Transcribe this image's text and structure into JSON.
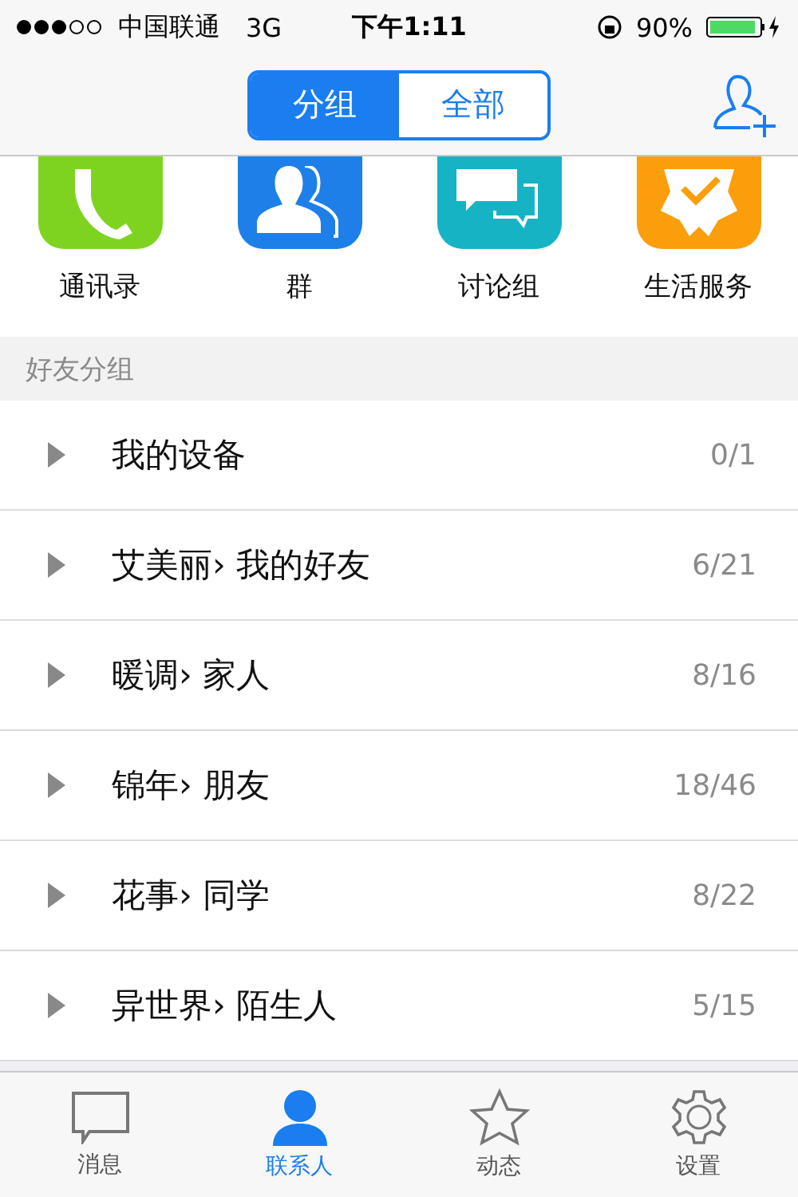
{
  "status_bar": {
    "carrier": "中国联通",
    "network": "3G",
    "time": "下午1:11",
    "battery": "90%"
  },
  "nav": {
    "segments": [
      {
        "label": "分组",
        "selected": true
      },
      {
        "label": "全部",
        "selected": false
      }
    ]
  },
  "shortcuts": [
    {
      "label": "通讯录",
      "kind": "phone",
      "color": "#7ed321"
    },
    {
      "label": "群",
      "kind": "group",
      "color": "#1f7fe8"
    },
    {
      "label": "讨论组",
      "kind": "chat",
      "color": "#16b3c4"
    },
    {
      "label": "生活服务",
      "kind": "badge",
      "color": "#fb9e0c"
    }
  ],
  "section_header": "好友分组",
  "groups": [
    {
      "name": "我的设备",
      "count": "0/1",
      "expanded": false
    },
    {
      "name": "艾美丽› 我的好友",
      "count": "6/21",
      "expanded": false
    },
    {
      "name": "暖调› 家人",
      "count": "8/16",
      "expanded": false
    },
    {
      "name": "锦年› 朋友",
      "count": "18/46",
      "expanded": false
    },
    {
      "name": "花事› 同学",
      "count": "8/22",
      "expanded": false
    },
    {
      "name": "异世界› 陌生人",
      "count": "5/15",
      "expanded": false
    }
  ],
  "tab_bar": [
    {
      "label": "消息",
      "kind": "chat",
      "selected": false
    },
    {
      "label": "联系人",
      "kind": "person",
      "selected": true
    },
    {
      "label": "动态",
      "kind": "star",
      "selected": false
    },
    {
      "label": "设置",
      "kind": "gear",
      "selected": false
    }
  ]
}
